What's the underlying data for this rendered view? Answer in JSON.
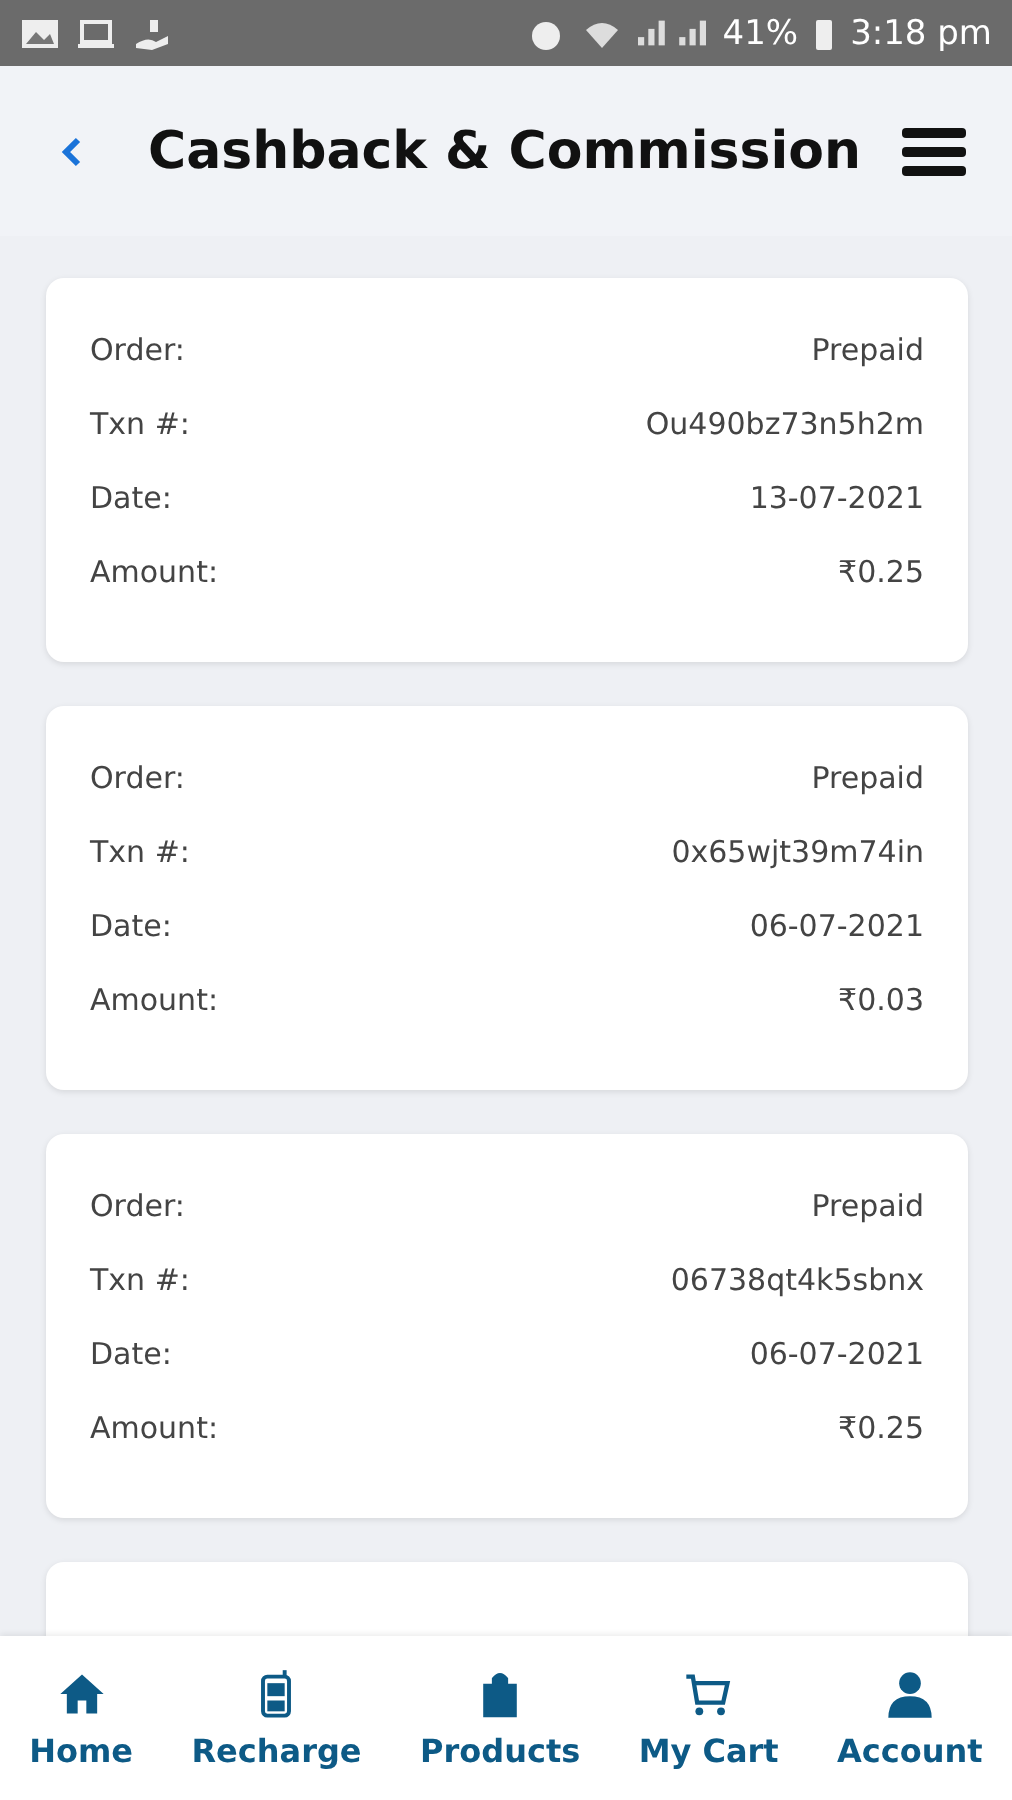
{
  "status_bar": {
    "battery": "41%",
    "time": "3:18 pm"
  },
  "header": {
    "title": "Cashback & Commission"
  },
  "transactions": [
    {
      "rows": [
        {
          "label": "Order:",
          "value": "Prepaid"
        },
        {
          "label": "Txn #:",
          "value": "Ou490bz73n5h2m"
        },
        {
          "label": "Date:",
          "value": "13-07-2021"
        },
        {
          "label": "Amount:",
          "value": "₹0.25"
        }
      ]
    },
    {
      "rows": [
        {
          "label": "Order:",
          "value": "Prepaid"
        },
        {
          "label": "Txn #:",
          "value": "0x65wjt39m74in"
        },
        {
          "label": "Date:",
          "value": "06-07-2021"
        },
        {
          "label": "Amount:",
          "value": "₹0.03"
        }
      ]
    },
    {
      "rows": [
        {
          "label": "Order:",
          "value": "Prepaid"
        },
        {
          "label": "Txn #:",
          "value": "06738qt4k5sbnx"
        },
        {
          "label": "Date:",
          "value": "06-07-2021"
        },
        {
          "label": "Amount:",
          "value": "₹0.25"
        }
      ]
    }
  ],
  "bottom_nav": [
    {
      "label": "Home"
    },
    {
      "label": "Recharge"
    },
    {
      "label": "Products"
    },
    {
      "label": "My Cart"
    },
    {
      "label": "Account"
    }
  ]
}
